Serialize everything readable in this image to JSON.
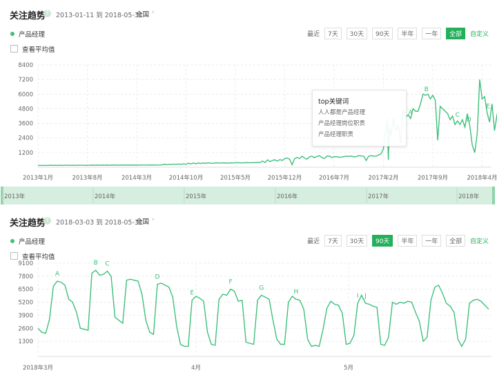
{
  "panel1": {
    "title": "关注趋势",
    "help_icon": "?",
    "date_range": "2013-01-11 到 2018-05-31",
    "region": "全国",
    "region_arrow": "›",
    "legend": "产品经理",
    "avg_label": "查看平均值",
    "recent_label": "最近",
    "periods": [
      "7天",
      "30天",
      "90天",
      "半年",
      "一年",
      "全部"
    ],
    "active_period": "全部",
    "custom_label": "自定义",
    "tooltip": {
      "title": "top关键词",
      "items": [
        "人人都是产品经理",
        "产品经理岗位职责",
        "产品经理职责"
      ]
    },
    "brush_labels": [
      "2013年",
      "2014年",
      "2015年",
      "2016年",
      "2017年",
      "2018年"
    ]
  },
  "panel2": {
    "title": "关注趋势",
    "help_icon": "?",
    "date_range": "2018-03-03 到 2018-05-31",
    "region": "全国",
    "region_arrow": "›",
    "legend": "产品经理",
    "avg_label": "查看平均值",
    "recent_label": "最近",
    "periods": [
      "7天",
      "30天",
      "90天",
      "半年",
      "一年",
      "全部"
    ],
    "active_period": "90天",
    "custom_label": "自定义"
  },
  "colors": {
    "line": "#3dbf7a",
    "accent": "#22b05a",
    "brush": "#d6eedf"
  },
  "chart_data": [
    {
      "type": "line",
      "series_label": "产品经理",
      "yticks": [
        1200,
        2400,
        3600,
        4800,
        6000,
        7200,
        8400
      ],
      "ylim": [
        0,
        8400
      ],
      "x_labels": [
        "2013年1月",
        "2013年8月",
        "2014年3月",
        "2014年10月",
        "2015年5月",
        "2015年12月",
        "2016年7月",
        "2017年2月",
        "2017年9月",
        "2018年4月"
      ],
      "annotations": [
        "A",
        "B",
        "C",
        "D",
        "E",
        "F"
      ],
      "points": [
        [
          0,
          150
        ],
        [
          0.05,
          150
        ],
        [
          0.1,
          150
        ],
        [
          0.15,
          150
        ],
        [
          0.2,
          150
        ],
        [
          0.25,
          160
        ],
        [
          0.3,
          150
        ],
        [
          0.35,
          160
        ],
        [
          0.4,
          150
        ],
        [
          0.45,
          160
        ],
        [
          0.5,
          150
        ],
        [
          0.55,
          160
        ],
        [
          0.6,
          160
        ],
        [
          0.65,
          150
        ],
        [
          0.7,
          160
        ],
        [
          0.75,
          150
        ],
        [
          0.8,
          160
        ],
        [
          0.85,
          160
        ],
        [
          0.9,
          160
        ],
        [
          0.95,
          150
        ],
        [
          1.0,
          160
        ],
        [
          1.05,
          160
        ],
        [
          1.1,
          170
        ],
        [
          1.15,
          160
        ],
        [
          1.2,
          170
        ],
        [
          1.25,
          160
        ],
        [
          1.3,
          170
        ],
        [
          1.35,
          160
        ],
        [
          1.4,
          170
        ],
        [
          1.45,
          160
        ],
        [
          1.5,
          170
        ],
        [
          1.55,
          170
        ],
        [
          1.6,
          160
        ],
        [
          1.7,
          170
        ],
        [
          1.8,
          170
        ],
        [
          1.9,
          170
        ],
        [
          2.0,
          170
        ],
        [
          2.1,
          175
        ],
        [
          2.2,
          175
        ],
        [
          2.3,
          180
        ],
        [
          2.4,
          175
        ],
        [
          2.5,
          180
        ],
        [
          2.55,
          230
        ],
        [
          2.6,
          200
        ],
        [
          2.65,
          240
        ],
        [
          2.7,
          210
        ],
        [
          2.75,
          250
        ],
        [
          2.8,
          220
        ],
        [
          2.85,
          260
        ],
        [
          2.9,
          230
        ],
        [
          2.95,
          270
        ],
        [
          3.0,
          240
        ],
        [
          3.05,
          330
        ],
        [
          3.1,
          260
        ],
        [
          3.15,
          340
        ],
        [
          3.2,
          280
        ],
        [
          3.25,
          350
        ],
        [
          3.3,
          300
        ],
        [
          3.35,
          340
        ],
        [
          3.4,
          320
        ],
        [
          3.45,
          360
        ],
        [
          3.5,
          330
        ],
        [
          3.55,
          320
        ],
        [
          3.6,
          350
        ],
        [
          3.65,
          360
        ],
        [
          3.7,
          330
        ],
        [
          3.75,
          360
        ],
        [
          3.8,
          340
        ],
        [
          3.85,
          330
        ],
        [
          3.9,
          360
        ],
        [
          3.95,
          350
        ],
        [
          4.0,
          360
        ],
        [
          4.05,
          380
        ],
        [
          4.1,
          350
        ],
        [
          4.15,
          360
        ],
        [
          4.2,
          370
        ],
        [
          4.25,
          380
        ],
        [
          4.3,
          360
        ],
        [
          4.35,
          380
        ],
        [
          4.4,
          370
        ],
        [
          4.45,
          390
        ],
        [
          4.5,
          380
        ],
        [
          4.55,
          500
        ],
        [
          4.6,
          380
        ],
        [
          4.65,
          600
        ],
        [
          4.7,
          450
        ],
        [
          4.75,
          550
        ],
        [
          4.8,
          600
        ],
        [
          4.85,
          500
        ],
        [
          4.9,
          620
        ],
        [
          4.95,
          550
        ],
        [
          5.0,
          700
        ],
        [
          5.05,
          750
        ],
        [
          5.1,
          650
        ],
        [
          5.15,
          200
        ],
        [
          5.2,
          700
        ],
        [
          5.25,
          800
        ],
        [
          5.3,
          700
        ],
        [
          5.35,
          900
        ],
        [
          5.4,
          750
        ],
        [
          5.45,
          650
        ],
        [
          5.5,
          850
        ],
        [
          5.55,
          900
        ],
        [
          5.6,
          780
        ],
        [
          5.65,
          880
        ],
        [
          5.7,
          950
        ],
        [
          5.75,
          800
        ],
        [
          5.8,
          700
        ],
        [
          5.85,
          900
        ],
        [
          5.9,
          920
        ],
        [
          5.95,
          800
        ],
        [
          6.0,
          850
        ],
        [
          6.05,
          870
        ],
        [
          6.1,
          820
        ],
        [
          6.15,
          830
        ],
        [
          6.2,
          870
        ],
        [
          6.25,
          900
        ],
        [
          6.3,
          880
        ],
        [
          6.35,
          920
        ],
        [
          6.4,
          850
        ],
        [
          6.45,
          870
        ],
        [
          6.5,
          950
        ],
        [
          6.6,
          900
        ],
        [
          6.65,
          550
        ],
        [
          6.7,
          900
        ],
        [
          6.75,
          950
        ],
        [
          6.8,
          900
        ],
        [
          6.85,
          900
        ],
        [
          6.9,
          1000
        ],
        [
          6.95,
          1100
        ],
        [
          7.0,
          1500
        ],
        [
          7.02,
          2500
        ],
        [
          7.05,
          3000
        ],
        [
          7.08,
          4000
        ],
        [
          7.1,
          600
        ],
        [
          7.12,
          3200
        ],
        [
          7.15,
          2600
        ],
        [
          7.2,
          4000
        ],
        [
          7.25,
          3000
        ],
        [
          7.3,
          3400
        ],
        [
          7.35,
          2000
        ],
        [
          7.4,
          4800
        ],
        [
          7.45,
          4100
        ],
        [
          7.5,
          4300
        ],
        [
          7.55,
          4000
        ],
        [
          7.6,
          4800
        ],
        [
          7.65,
          4600
        ],
        [
          7.7,
          4600
        ],
        [
          7.75,
          5200
        ],
        [
          7.8,
          6000
        ],
        [
          7.85,
          5900
        ],
        [
          7.9,
          6000
        ],
        [
          7.95,
          5600
        ],
        [
          8.0,
          5900
        ],
        [
          8.05,
          5500
        ],
        [
          8.1,
          2200
        ],
        [
          8.15,
          5000
        ],
        [
          8.2,
          4800
        ],
        [
          8.25,
          4600
        ],
        [
          8.3,
          4400
        ],
        [
          8.35,
          3900
        ],
        [
          8.4,
          4200
        ],
        [
          8.45,
          3500
        ],
        [
          8.5,
          3800
        ],
        [
          8.55,
          3500
        ],
        [
          8.6,
          3900
        ],
        [
          8.65,
          3300
        ],
        [
          8.7,
          4400
        ],
        [
          8.75,
          3400
        ],
        [
          8.8,
          1800
        ],
        [
          8.85,
          1200
        ],
        [
          8.9,
          2800
        ],
        [
          8.95,
          7200
        ],
        [
          9.0,
          5600
        ],
        [
          9.05,
          5800
        ],
        [
          9.1,
          4500
        ],
        [
          9.15,
          3700
        ],
        [
          9.2,
          5200
        ],
        [
          9.25,
          3000
        ],
        [
          9.3,
          4300
        ],
        [
          9.35,
          3900
        ],
        [
          9.4,
          4400
        ]
      ]
    },
    {
      "type": "line",
      "series_label": "产品经理",
      "yticks": [
        1300,
        2600,
        3900,
        5200,
        6500,
        7800,
        9100
      ],
      "ylim": [
        0,
        9100
      ],
      "x_labels": [
        "2018年3月",
        "4月",
        "5月"
      ],
      "annotations": [
        "A",
        "B",
        "C",
        "D",
        "E",
        "F",
        "G",
        "H",
        "I",
        "J"
      ],
      "values": [
        2600,
        2200,
        2100,
        3500,
        6800,
        7300,
        7200,
        6900,
        5500,
        5200,
        4200,
        2600,
        2500,
        2400,
        8100,
        8400,
        7900,
        8000,
        8300,
        7800,
        3700,
        3400,
        3100,
        7400,
        7500,
        7400,
        7300,
        6000,
        3400,
        2200,
        2000,
        7000,
        7100,
        6900,
        6700,
        5700,
        2800,
        1000,
        800,
        800,
        5400,
        5800,
        5600,
        5300,
        2200,
        1000,
        900,
        5500,
        6000,
        5900,
        6500,
        6300,
        5300,
        5400,
        1200,
        1100,
        1000,
        5400,
        5900,
        5700,
        5500,
        3400,
        1500,
        1000,
        1000,
        5200,
        5800,
        5500,
        5400,
        4500,
        1500,
        800,
        900,
        800,
        2500,
        4600,
        5300,
        5000,
        4900,
        4100,
        1000,
        1100,
        1900,
        5100,
        5900,
        5100,
        5000,
        4800,
        4700,
        1000,
        900,
        1700,
        5200,
        5000,
        5200,
        5100,
        5300,
        5200,
        4200,
        3300,
        1300,
        1700,
        5400,
        6700,
        6900,
        6100,
        5100,
        4800,
        4200,
        1500,
        800,
        1500,
        5100,
        5400,
        5500,
        5300,
        4900,
        4500
      ]
    }
  ]
}
